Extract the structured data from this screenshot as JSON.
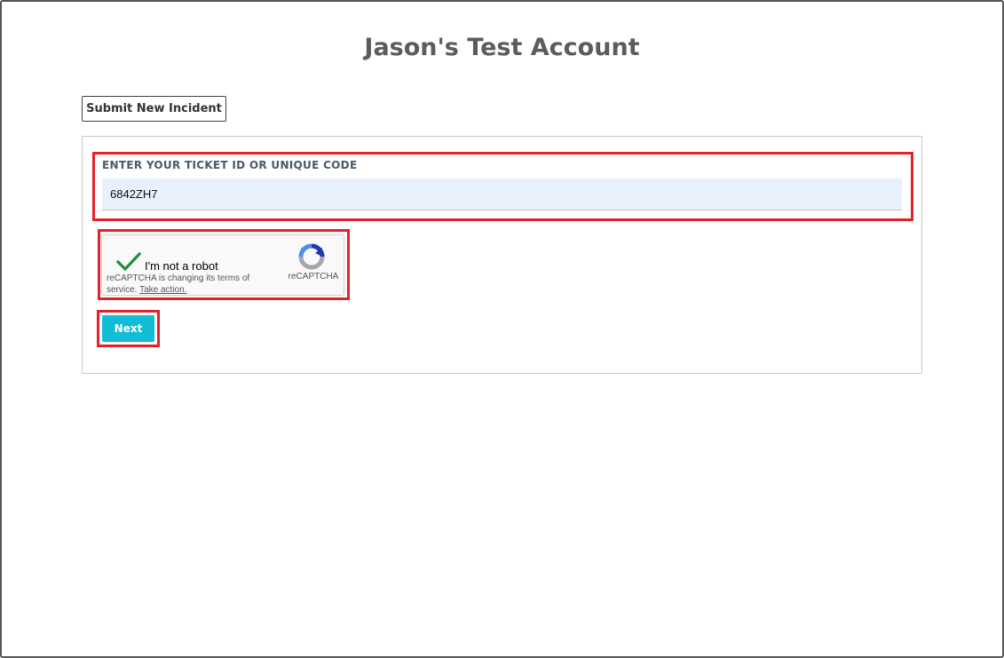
{
  "page": {
    "title": "Jason's Test Account"
  },
  "actions": {
    "submit_new_incident_label": "Submit New Incident"
  },
  "ticket_form": {
    "field_label": "ENTER YOUR TICKET ID OR UNIQUE CODE",
    "ticket_value": "6842ZH7",
    "next_label": "Next"
  },
  "recaptcha": {
    "checked": true,
    "check_label": "I'm not a robot",
    "notice_text": "reCAPTCHA is changing its terms of service.",
    "notice_link": "Take action.",
    "brand": "reCAPTCHA"
  },
  "colors": {
    "accent": "#12bcd4",
    "highlight": "#e3222a",
    "check": "#1e8e3e",
    "input_bg": "#e8f0fb",
    "title": "#5c5c5c"
  },
  "icons": {
    "captcha_check": "check-icon",
    "captcha_logo": "recaptcha-logo-icon"
  }
}
